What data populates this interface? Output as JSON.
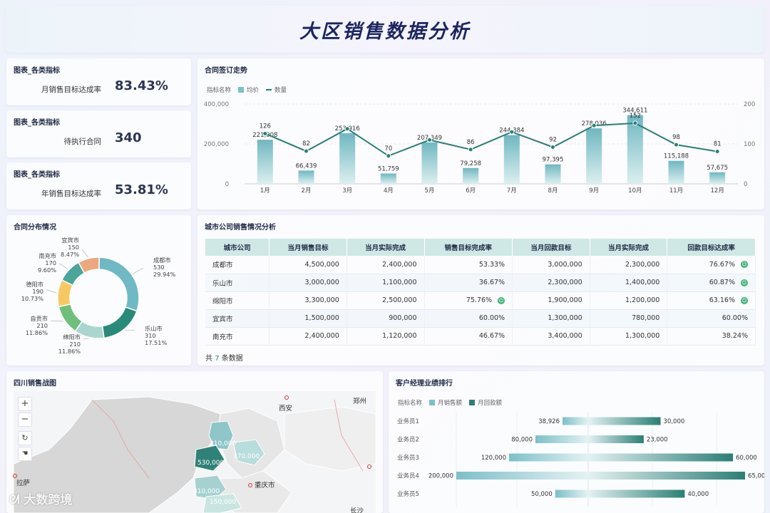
{
  "header": {
    "title": "大区销售数据分析"
  },
  "kpis": [
    {
      "panel_title": "图表_各类指标",
      "label": "月销售目标达成率",
      "value": "83.43%"
    },
    {
      "panel_title": "图表_各类指标",
      "label": "待执行合同",
      "value": "340"
    },
    {
      "panel_title": "图表_各类指标",
      "label": "年销售目标达成率",
      "value": "53.81%"
    }
  ],
  "contract_trend": {
    "title": "合同签订走势",
    "legend": {
      "prefix": "指标名称",
      "bar": "均价",
      "line": "数量"
    }
  },
  "contract_distribution": {
    "title": "合同分布情况"
  },
  "city_table": {
    "title": "城市公司销售情况分析",
    "columns": [
      "城市公司",
      "当月销售目标",
      "当月实际完成",
      "销售目标完成率",
      "当月回款目标",
      "当月实际完成",
      "回款目标达成率"
    ],
    "rows": [
      [
        "成都市",
        "4,500,000",
        "2,400,000",
        "53.33%",
        "3,000,000",
        "2,300,000",
        "76.67%"
      ],
      [
        "乐山市",
        "3,000,000",
        "1,100,000",
        "36.67%",
        "2,300,000",
        "1,400,000",
        "60.87%"
      ],
      [
        "绵阳市",
        "3,300,000",
        "2,500,000",
        "75.76%",
        "1,900,000",
        "1,200,000",
        "63.16%"
      ],
      [
        "宜宾市",
        "1,500,000",
        "900,000",
        "60.00%",
        "1,300,000",
        "780,000",
        "60.00%"
      ],
      [
        "南充市",
        "2,400,000",
        "1,120,000",
        "46.67%",
        "3,400,000",
        "1,300,000",
        "38.24%"
      ]
    ],
    "smileys": [
      [
        false,
        true
      ],
      [
        false,
        true
      ],
      [
        true,
        true
      ],
      [
        false,
        false
      ],
      [
        false,
        false
      ]
    ],
    "footer": {
      "prefix": "共",
      "count": "7",
      "suffix": "条数据"
    }
  },
  "map": {
    "title": "四川销售战图",
    "cities": [
      "西安",
      "郑州",
      "重庆市",
      "拉萨",
      "长沙"
    ],
    "values": [
      "210,000",
      "170,000",
      "530,000",
      "310,000",
      "150,000"
    ],
    "brand": "大数跨境"
  },
  "ranking": {
    "title": "客户经理业绩排行",
    "legend": {
      "prefix": "指标名称",
      "sales": "月销售额",
      "payment": "月回款额"
    }
  },
  "colors": {
    "teal_dark": "#2a7f75",
    "teal_light": "#7cc0c8",
    "title_navy": "#1c2660"
  },
  "chart_data": [
    {
      "type": "bar+line",
      "title": "合同签订走势",
      "categories": [
        "1月",
        "2月",
        "3月",
        "4月",
        "5月",
        "6月",
        "7月",
        "8月",
        "9月",
        "10月",
        "11月",
        "12月"
      ],
      "series": [
        {
          "name": "均价",
          "type": "bar",
          "axis": "left",
          "values": [
            221008,
            66439,
            253916,
            51759,
            207349,
            79258,
            244384,
            97395,
            278036,
            344611,
            115188,
            57675
          ]
        },
        {
          "name": "数量",
          "type": "line",
          "axis": "right",
          "values": [
            126,
            82,
            138,
            70,
            110,
            86,
            130,
            92,
            146,
            152,
            98,
            81
          ]
        }
      ],
      "labels_bar": [
        "221,008",
        "66,439",
        "253,916",
        "51,759",
        "207,349",
        "79,258",
        "244,384",
        "97,395",
        "278,036",
        "344,611",
        "115,188",
        "57,675"
      ],
      "labels_line": [
        "126",
        "82",
        "",
        "70",
        "",
        "86",
        "",
        "92",
        "",
        "152",
        "98",
        "81"
      ],
      "y_left_ticks": [
        "400,000",
        "200,000",
        "0"
      ],
      "y_right_ticks": [
        "200",
        "100",
        "0"
      ],
      "ylim_left": [
        0,
        400000
      ],
      "ylim_right": [
        0,
        200
      ]
    },
    {
      "type": "pie",
      "title": "合同分布情况",
      "slices": [
        {
          "name": "成都市",
          "value": 530,
          "pct": "29.94%",
          "color": "#6fb9c4"
        },
        {
          "name": "乐山市",
          "value": 310,
          "pct": "17.51%",
          "color": "#2a8a7a"
        },
        {
          "name": "绵阳市",
          "value": 210,
          "pct": "11.86%",
          "color": "#a9d6cf"
        },
        {
          "name": "自贡市",
          "value": 210,
          "pct": "11.86%",
          "color": "#6fbf7a"
        },
        {
          "name": "德阳市",
          "value": 190,
          "pct": "10.73%",
          "color": "#f7c862"
        },
        {
          "name": "南充市",
          "value": 170,
          "pct": "9.60%",
          "color": "#4aa59b"
        },
        {
          "name": "宜宾市",
          "value": 150,
          "pct": "8.47%",
          "color": "#eda77f"
        }
      ]
    },
    {
      "type": "bar",
      "title": "客户经理业绩排行",
      "categories": [
        "业务员1",
        "业务员2",
        "业务员3",
        "业务员4",
        "业务员5"
      ],
      "series": [
        {
          "name": "月销售额",
          "values": [
            38926,
            80000,
            120000,
            200000,
            50000
          ]
        },
        {
          "name": "月回款额",
          "values": [
            30000,
            23000,
            60000,
            65000,
            40000
          ]
        }
      ],
      "labels_sales": [
        "38,926",
        "80,000",
        "120,000",
        "200,000",
        "50,000"
      ],
      "labels_payment": [
        "30,000",
        "23,000",
        "60,000",
        "65,000",
        "40,000"
      ]
    }
  ]
}
